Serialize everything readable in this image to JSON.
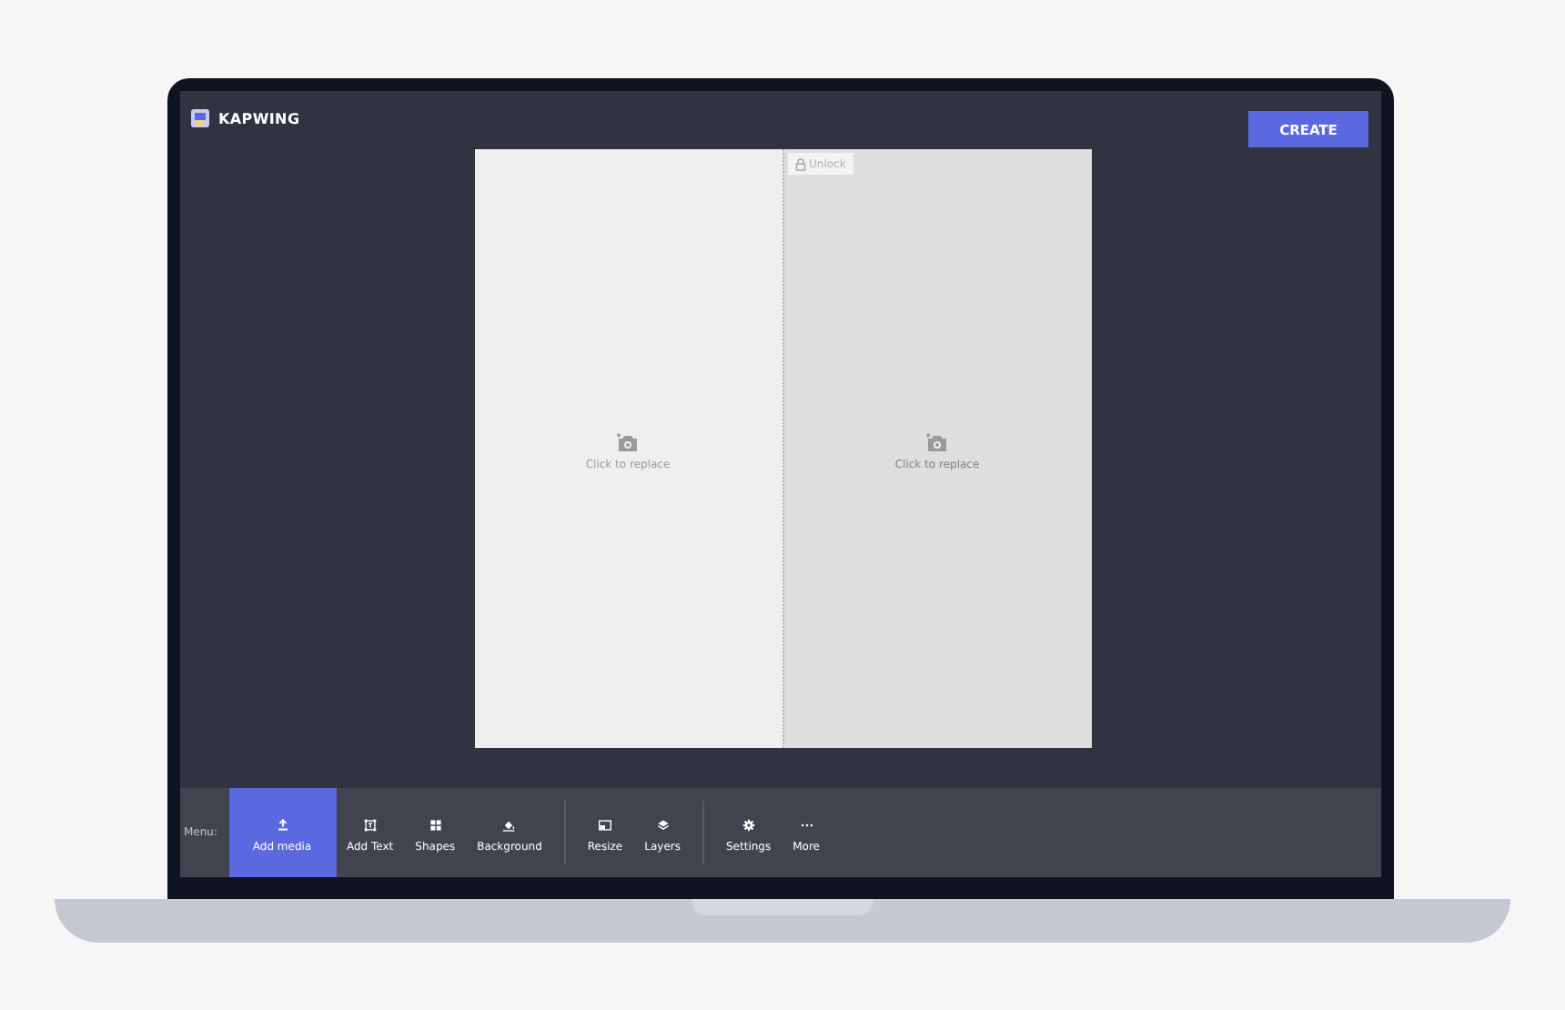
{
  "app": {
    "logo": "KAPWING",
    "create_button": "CREATE"
  },
  "canvas": {
    "panels": [
      {
        "placeholder": "Click to replace",
        "locked": false
      },
      {
        "placeholder": "Click to replace",
        "locked": true,
        "lock_button": "Unlock"
      }
    ]
  },
  "menu": {
    "label": "Menu:",
    "groups": [
      [
        {
          "label": "Add media",
          "selected": true
        },
        {
          "label": "Add Text",
          "selected": false
        },
        {
          "label": "Shapes",
          "selected": false
        },
        {
          "label": "Background",
          "selected": false
        }
      ],
      [
        {
          "label": "Resize",
          "selected": false
        },
        {
          "label": "Layers",
          "selected": false
        }
      ],
      [
        {
          "label": "Settings",
          "selected": false
        },
        {
          "label": "More",
          "selected": false
        }
      ]
    ]
  }
}
